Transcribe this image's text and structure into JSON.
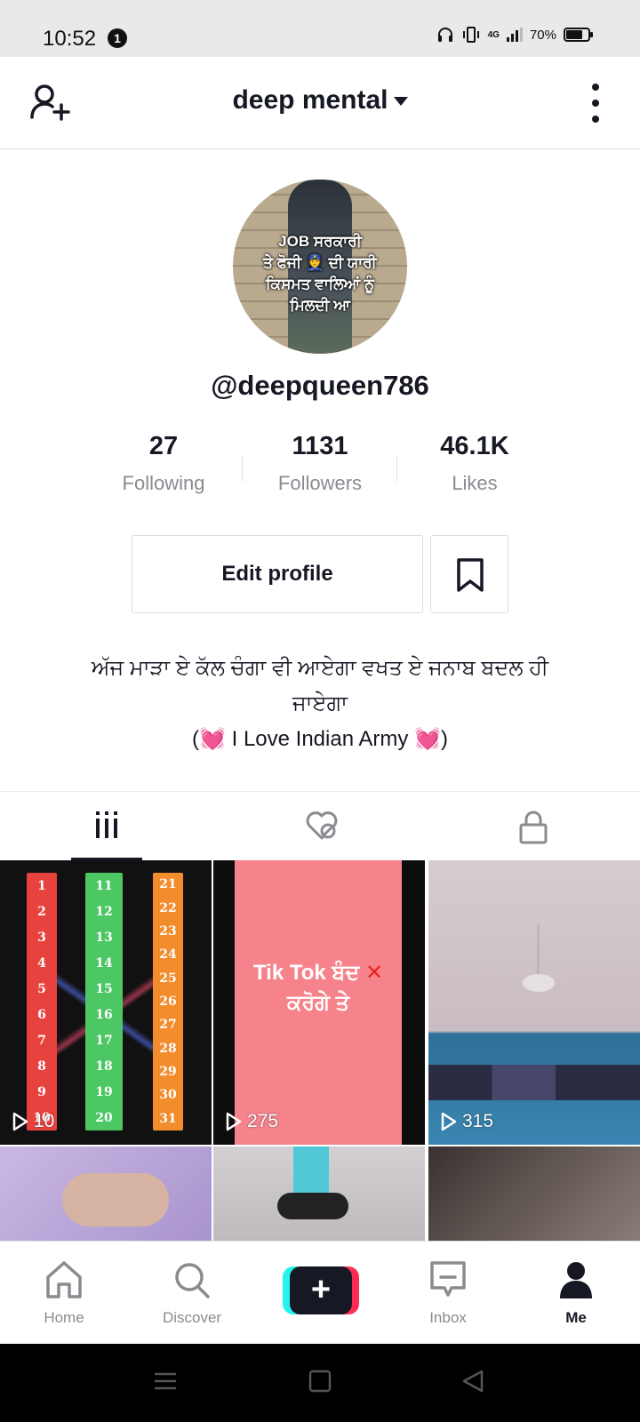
{
  "status_bar": {
    "time": "10:52",
    "notification_count": "1",
    "network": "4G",
    "battery": "70%"
  },
  "header": {
    "title": "deep mental",
    "add_friend_icon": "add-user-icon",
    "more_icon": "more-vertical-icon"
  },
  "profile": {
    "avatar_caption": [
      "JOB ਸਰਕਾਰੀ",
      "ਤੇ ਫੋਜੀ 👮 ਦੀ ਯਾਰੀ",
      "ਕਿਸਮਤ ਵਾਲਿਆਂ ਨੂੰ",
      "ਮਿਲਦੀ ਆ"
    ],
    "username": "@deepqueen786",
    "stats": [
      {
        "value": "27",
        "label": "Following"
      },
      {
        "value": "1131",
        "label": "Followers"
      },
      {
        "value": "46.1K",
        "label": "Likes"
      }
    ],
    "edit_profile_label": "Edit profile",
    "bio_line1": "ਅੱਜ ਮਾੜਾ ਏ ਕੱਲ ਚੰਗਾ ਵੀ ਆਏਗਾ ਵਖਤ ਏ ਜਨਾਬ ਬਦਲ ਹੀ",
    "bio_line2": "ਜਾਏਗਾ",
    "bio_line3_prefix": "(",
    "bio_line3_heart": "💓",
    "bio_line3_text": " I Love Indian Army ",
    "bio_line3_suffix": ")"
  },
  "tabs": [
    {
      "name": "videos",
      "icon": "grid-icon",
      "active": true
    },
    {
      "name": "liked",
      "icon": "hidden-heart-icon",
      "active": false
    },
    {
      "name": "private",
      "icon": "lock-icon",
      "active": false
    }
  ],
  "videos": [
    {
      "views": "10",
      "overlay": "",
      "numbers": {
        "red": [
          "1",
          "2",
          "3",
          "4",
          "5",
          "6",
          "7",
          "8",
          "9",
          "10"
        ],
        "green": [
          "11",
          "12",
          "13",
          "14",
          "15",
          "16",
          "17",
          "18",
          "19",
          "20"
        ],
        "orange": [
          "21",
          "22",
          "23",
          "24",
          "25",
          "26",
          "27",
          "28",
          "29",
          "30",
          "31"
        ]
      }
    },
    {
      "views": "275",
      "overlay_line1": "Tik Tok ਬੰਦ",
      "overlay_x": "✕",
      "overlay_line2": "ਕਰੋਗੇ ਤੇ"
    },
    {
      "views": "315"
    },
    {
      "views": ""
    },
    {
      "views": ""
    },
    {
      "views": ""
    }
  ],
  "bottom_nav": [
    {
      "label": "Home",
      "icon": "home-icon",
      "active": false
    },
    {
      "label": "Discover",
      "icon": "search-icon",
      "active": false
    },
    {
      "label": "",
      "icon": "plus-icon",
      "active": false
    },
    {
      "label": "Inbox",
      "icon": "inbox-icon",
      "active": false
    },
    {
      "label": "Me",
      "icon": "person-icon",
      "active": true
    }
  ],
  "create_button_symbol": "+",
  "colors": {
    "text_primary": "#161823",
    "text_secondary": "#8a8b91",
    "tiktok_cyan": "#25f4ee",
    "tiktok_red": "#fe2c55"
  }
}
